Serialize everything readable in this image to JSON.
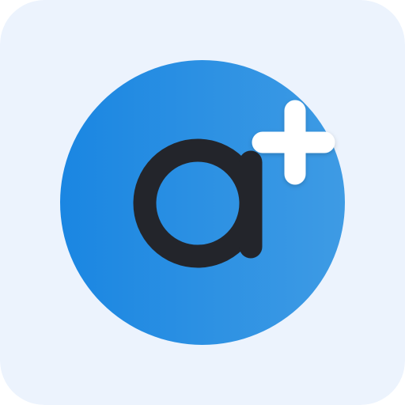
{
  "app_icon": {
    "name": "a-plus-icon",
    "glyph": "a",
    "badge": "+",
    "colors": {
      "tile_background": "#ECF3FD",
      "circle_left": "#1A86E2",
      "circle_right": "#3E9BE4",
      "letter": "#23252B",
      "plus": "#FFFFFF"
    }
  }
}
